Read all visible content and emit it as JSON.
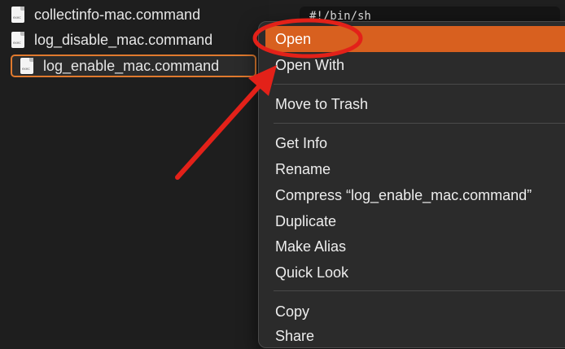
{
  "files": [
    {
      "name": "collectinfo-mac.command",
      "selected": false
    },
    {
      "name": "log_disable_mac.command",
      "selected": false
    },
    {
      "name": "log_enable_mac.command",
      "selected": true
    }
  ],
  "file_icon_badge": "exec",
  "preview": {
    "text": "#!/bin/sh"
  },
  "context_menu": {
    "open": "Open",
    "open_with": "Open With",
    "move_to_trash": "Move to Trash",
    "get_info": "Get Info",
    "rename": "Rename",
    "compress": "Compress “log_enable_mac.command”",
    "duplicate": "Duplicate",
    "make_alias": "Make Alias",
    "quick_look": "Quick Look",
    "copy": "Copy",
    "share": "Share"
  },
  "colors": {
    "highlight": "#d8601f",
    "annotation_red": "#e32119",
    "selection_border": "#e07a2e"
  }
}
